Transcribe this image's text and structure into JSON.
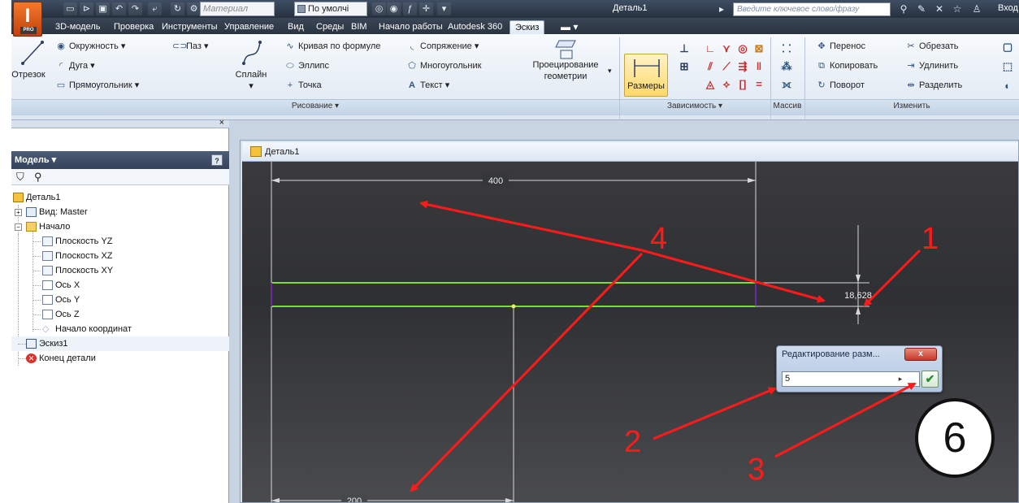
{
  "app": {
    "logo_letter": "I",
    "logo_badge": "PRO",
    "title": "Деталь1",
    "material_placeholder": "Материал",
    "appearance_value": "По умолчі",
    "search_placeholder": "Введите ключевое слово/фразу",
    "signin_label": "Вход"
  },
  "tabs": [
    {
      "label": "3D-модель"
    },
    {
      "label": "Проверка"
    },
    {
      "label": "Инструменты"
    },
    {
      "label": "Управление"
    },
    {
      "label": "Вид"
    },
    {
      "label": "Среды"
    },
    {
      "label": "BIM"
    },
    {
      "label": "Начало работы"
    },
    {
      "label": "Autodesk 360"
    },
    {
      "label": "Эскиз",
      "active": true
    }
  ],
  "ribbon": {
    "line_label": "Отрезок",
    "circle_label": "Окружность",
    "arc_label": "Дуга",
    "rectangle_label": "Прямоугольник",
    "slot_label": "Паз",
    "spline_label": "Сплайн",
    "equation_curve_label": "Кривая по формуле",
    "ellipse_label": "Эллипс",
    "point_label": "Точка",
    "fillet_label": "Сопряжение",
    "polygon_label": "Многоугольник",
    "text_label": "Текст",
    "project_geometry_label_1": "Проецирование",
    "project_geometry_label_2": "геометрии",
    "dimensions_label": "Размеры",
    "move_label": "Перенос",
    "copy_label": "Копировать",
    "rotate_label": "Поворот",
    "trim_label": "Обрезать",
    "extend_label": "Удлинить",
    "split_label": "Разделить",
    "panel_draw": "Рисование",
    "panel_constrain": "Зависимость",
    "panel_pattern": "Массив",
    "panel_modify": "Изменить"
  },
  "browser": {
    "title": "Модель",
    "help_label": "?",
    "close_label": "×",
    "tree": [
      {
        "label": "Деталь1",
        "icon": "part-icon"
      },
      {
        "label": "Вид: Master",
        "icon": "view-icon"
      },
      {
        "label": "Начало",
        "icon": "folder-icon"
      },
      {
        "label": "Плоскость YZ",
        "icon": "plane-icon"
      },
      {
        "label": "Плоскость XZ",
        "icon": "plane-icon"
      },
      {
        "label": "Плоскость XY",
        "icon": "plane-icon"
      },
      {
        "label": "Ось X",
        "icon": "axis-icon"
      },
      {
        "label": "Ось Y",
        "icon": "axis-icon"
      },
      {
        "label": "Ось Z",
        "icon": "axis-icon"
      },
      {
        "label": "Начало координат",
        "icon": "origin-icon"
      },
      {
        "label": "Эскиз1",
        "icon": "sketch-icon"
      },
      {
        "label": "Конец детали",
        "icon": "end-of-part-icon"
      }
    ]
  },
  "document": {
    "tab_title": "Деталь1"
  },
  "sketch": {
    "dim_top": "400",
    "dim_height": "18,628",
    "dim_bottom": "200",
    "line_color": "#7fdc28"
  },
  "dialog": {
    "title": "Редактирование разм...",
    "close_label": "x",
    "input_value": "5",
    "ok_label": "✔"
  },
  "annotations": {
    "labels": [
      "1",
      "2",
      "3",
      "4"
    ],
    "step": "6",
    "color": "#ff1a1a"
  }
}
